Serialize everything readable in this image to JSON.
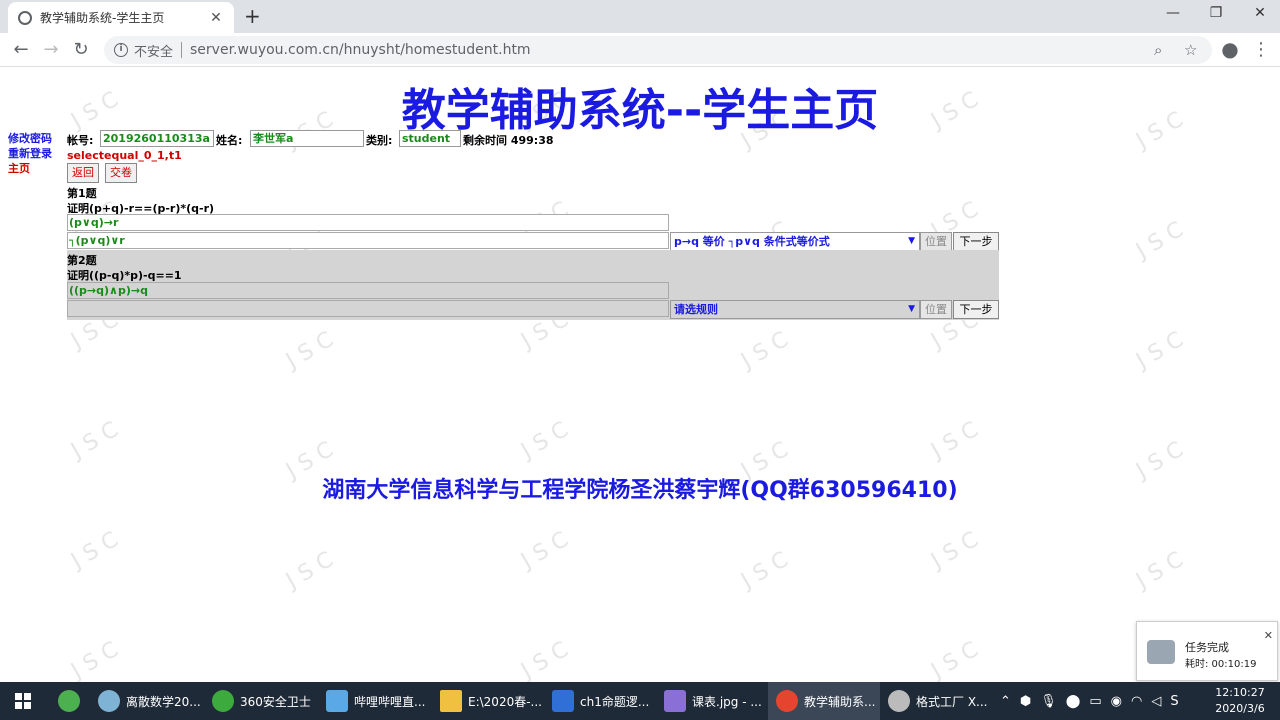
{
  "browser": {
    "tab_title": "教学辅助系统-学生主页",
    "tab_close": "✕",
    "new_tab": "+",
    "insecure_label": "不安全",
    "url": "server.wuyou.com.cn/hnuysht/homestudent.htm"
  },
  "page": {
    "title": "教学辅助系统--学生主页",
    "sidebar": [
      "修改密码",
      "重新登录",
      "主页"
    ],
    "account_label": "帐号:",
    "account_value": "2019260110313a",
    "name_label": "姓名:",
    "name_value": "李世军a",
    "type_label": "类别:",
    "type_value": "student",
    "time_label": "剩余时间 499:38",
    "status_text": "selectequal_0_1,t1",
    "back_button": "返回",
    "submit_button": "交卷",
    "q1_label": "第1题",
    "q1_statement": "证明(p+q)-r==(p-r)*(q-r)",
    "q1_expr1": "(p∨q)→r",
    "q1_expr2": "┐(p∨q)∨r",
    "q1_rule": "p→q 等价 ┐p∨q 条件式等价式",
    "position_button": "位置",
    "next_button": "下一步",
    "q2_label": "第2题",
    "q2_statement": "证明((p-q)*p)-q==1",
    "q2_expr1": "((p→q)∧p)→q",
    "q2_rule": "请选规则",
    "footer": "湖南大学信息科学与工程学院杨圣洪蔡宇辉(QQ群630596410)",
    "watermark": "J S C"
  },
  "toast": {
    "title": "任务完成",
    "detail": "耗时: 00:10:19"
  },
  "taskbar": {
    "items": [
      "离散数学20...",
      "360安全卫士",
      "哔哩哔哩直...",
      "E:\\2020春-...",
      "ch1命题逻...",
      "课表.jpg - ...",
      "教学辅助系...",
      "格式工厂 X..."
    ],
    "time": "12:10:27",
    "date": "2020/3/6"
  }
}
